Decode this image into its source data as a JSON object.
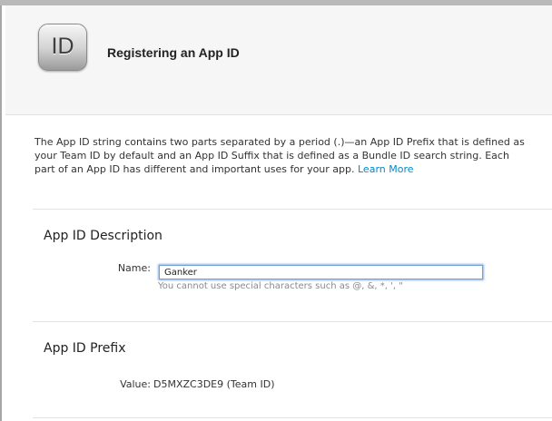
{
  "header": {
    "icon_text": "ID",
    "title": "Registering an App ID"
  },
  "intro": {
    "text": "The App ID string contains two parts separated by a period (.)—an App ID Prefix that is defined as your Team ID by default and an App ID Suffix that is defined as a Bundle ID search string. Each part of an App ID has different and important uses for your app.",
    "link_text": "Learn More"
  },
  "description_section": {
    "title": "App ID Description",
    "name_label": "Name:",
    "name_value": "Ganker",
    "hint": "You cannot use special characters such as @, &, *, ', \""
  },
  "prefix_section": {
    "title": "App ID Prefix",
    "value_label": "Value:",
    "value": "D5MXZC3DE9 (Team ID)"
  }
}
